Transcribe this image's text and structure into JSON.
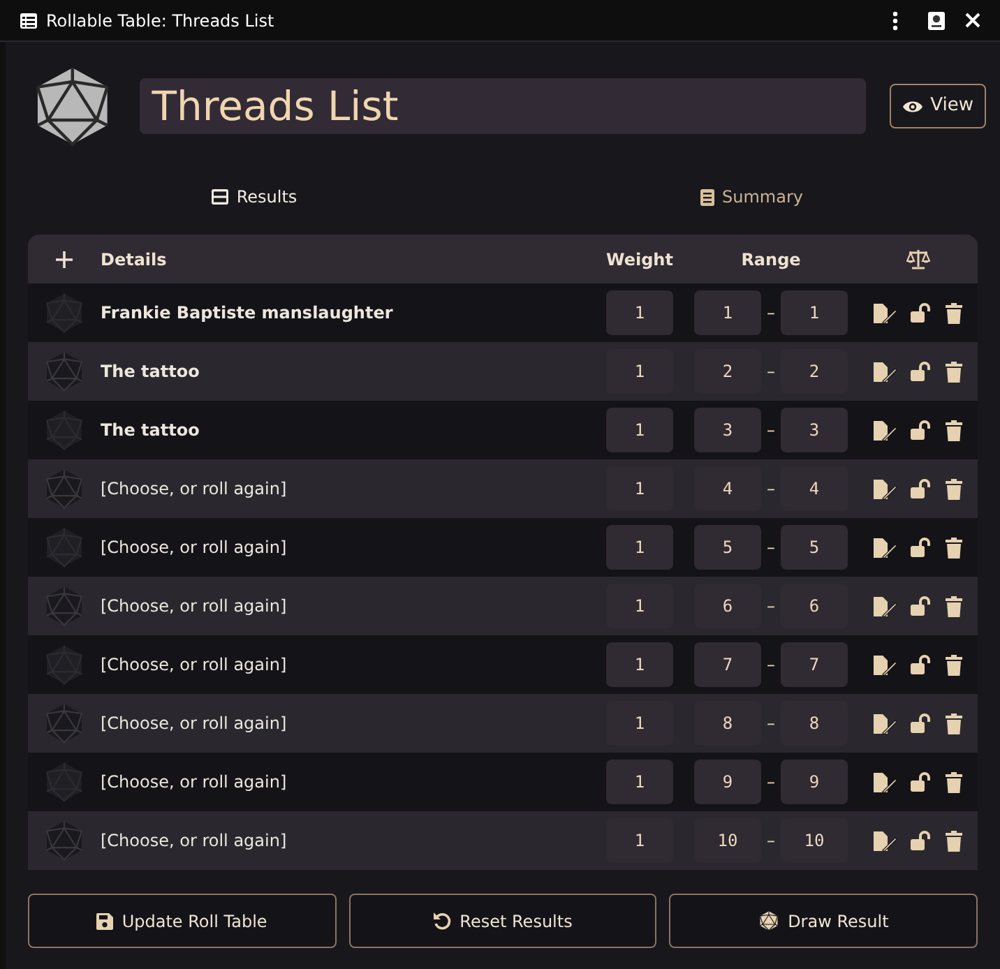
{
  "window": {
    "title": "Rollable Table: Threads List"
  },
  "header": {
    "name": "Threads List",
    "view_button": "View"
  },
  "tabs": [
    {
      "label": "Results",
      "selected": true
    },
    {
      "label": "Summary",
      "selected": false
    }
  ],
  "table": {
    "columns": [
      "Details",
      "Weight",
      "Range"
    ],
    "range_separator": "–",
    "rows": [
      {
        "text": "Frankie Baptiste manslaughter",
        "bold": true,
        "weight": "1",
        "range_from": "1",
        "range_to": "1"
      },
      {
        "text": "The tattoo",
        "bold": true,
        "weight": "1",
        "range_from": "2",
        "range_to": "2"
      },
      {
        "text": "The tattoo",
        "bold": true,
        "weight": "1",
        "range_from": "3",
        "range_to": "3"
      },
      {
        "text": "[Choose, or roll again]",
        "bold": false,
        "weight": "1",
        "range_from": "4",
        "range_to": "4"
      },
      {
        "text": "[Choose, or roll again]",
        "bold": false,
        "weight": "1",
        "range_from": "5",
        "range_to": "5"
      },
      {
        "text": "[Choose, or roll again]",
        "bold": false,
        "weight": "1",
        "range_from": "6",
        "range_to": "6"
      },
      {
        "text": "[Choose, or roll again]",
        "bold": false,
        "weight": "1",
        "range_from": "7",
        "range_to": "7"
      },
      {
        "text": "[Choose, or roll again]",
        "bold": false,
        "weight": "1",
        "range_from": "8",
        "range_to": "8"
      },
      {
        "text": "[Choose, or roll again]",
        "bold": false,
        "weight": "1",
        "range_from": "9",
        "range_to": "9"
      },
      {
        "text": "[Choose, or roll again]",
        "bold": false,
        "weight": "1",
        "range_from": "10",
        "range_to": "10"
      }
    ]
  },
  "footer_buttons": [
    {
      "kind": "save",
      "label": "Update Roll Table"
    },
    {
      "kind": "reset",
      "label": "Reset Results"
    },
    {
      "kind": "draw",
      "label": "Draw Result"
    }
  ]
}
